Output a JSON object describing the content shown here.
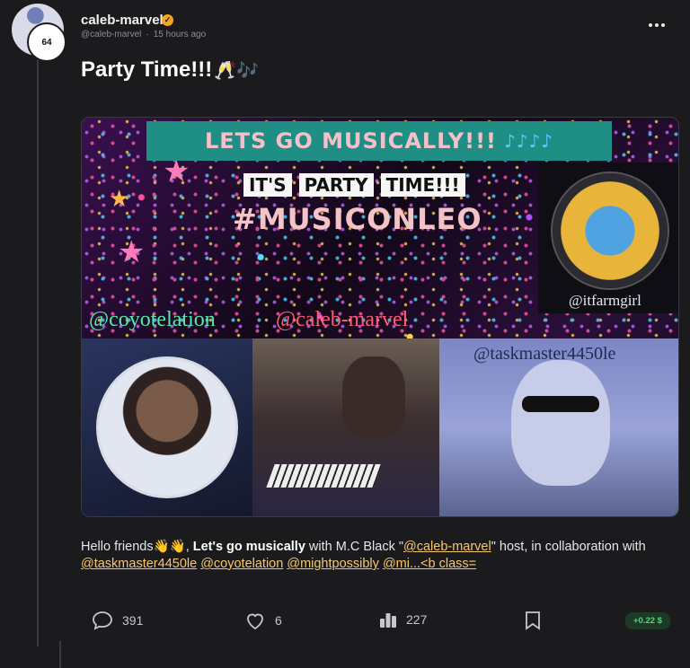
{
  "author": {
    "name": "caleb-marvel",
    "handle": "@caleb-marvel",
    "time": "15 hours ago",
    "reputation": "64"
  },
  "post": {
    "title": "Party Time!!!",
    "title_emoji": "🥂🎶",
    "image": {
      "banner": "LETS GO MUSICALLY!!!",
      "banner_notes": "♪♪♪♪",
      "party_words": [
        "IT'S",
        "PARTY",
        "TIME!!!"
      ],
      "hashtag": "#MUSICONLEO",
      "tags": {
        "top_right": "@itfarmgirl",
        "left": "@coyotelation",
        "middle": "@caleb-marvel",
        "right": "@taskmaster4450le"
      }
    },
    "body": {
      "greeting": "Hello friends",
      "wave_emoji": "👋👋",
      "bold_text": "Let's go musically",
      "text_1": " with M.C Black \"",
      "link_1": "@caleb-marvel",
      "text_2": "\" host, in collaboration with ",
      "link_2": "@taskmaster4450le",
      "link_3": "@coyotelation",
      "link_4": "@mightpossibly",
      "link_5": "@mi...<b class="
    }
  },
  "actions": {
    "comments": "391",
    "likes": "6",
    "views": "227",
    "payout": "+0.22 $"
  },
  "icons": {
    "comment": "comment-icon",
    "like": "heart-icon",
    "views": "bar-chart-icon",
    "bookmark": "bookmark-icon",
    "more": "more-dots-icon",
    "verified": "verified-badge-icon"
  },
  "colors": {
    "background": "#1b1b1e",
    "link": "#f7c86b",
    "payout_bg": "#1d3a26",
    "payout_text": "#56d37f",
    "verified": "#f5a623"
  }
}
